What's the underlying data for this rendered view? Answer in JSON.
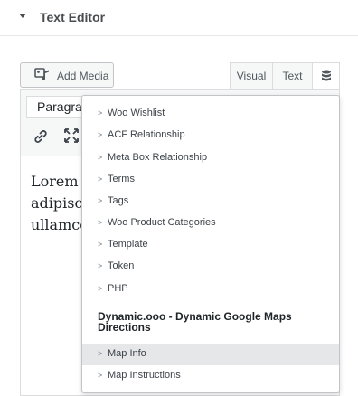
{
  "section": {
    "title": "Text Editor"
  },
  "media_button": {
    "label": "Add Media"
  },
  "tabs": {
    "visual": "Visual",
    "text": "Text",
    "dynamic_icon": "database-icon"
  },
  "toolbar": {
    "format_value": "Paragraph",
    "icons": [
      "link-icon",
      "fullscreen-icon"
    ]
  },
  "editor": {
    "lines": [
      "Lorem ipsum dolor sit amet, consectetur",
      "adipiscing elit. Ut elit tellus, luctus nec",
      "ullamcorper mattis, pulvinar dapibus leo."
    ]
  },
  "dropdown": {
    "items_top": [
      "Woo Wishlist",
      "ACF Relationship",
      "Meta Box Relationship",
      "Terms",
      "Tags",
      "Woo Product Categories",
      "Template",
      "Token",
      "PHP"
    ],
    "group_title": "Dynamic.ooo - Dynamic Google Maps Directions",
    "items_group": [
      "Map Info",
      "Map Instructions"
    ],
    "highlighted": "Map Info"
  },
  "colors": {
    "hover_bg": "#e5e7e9",
    "border": "#c3c4c7",
    "toolbar_bg": "#f6f7f7"
  }
}
